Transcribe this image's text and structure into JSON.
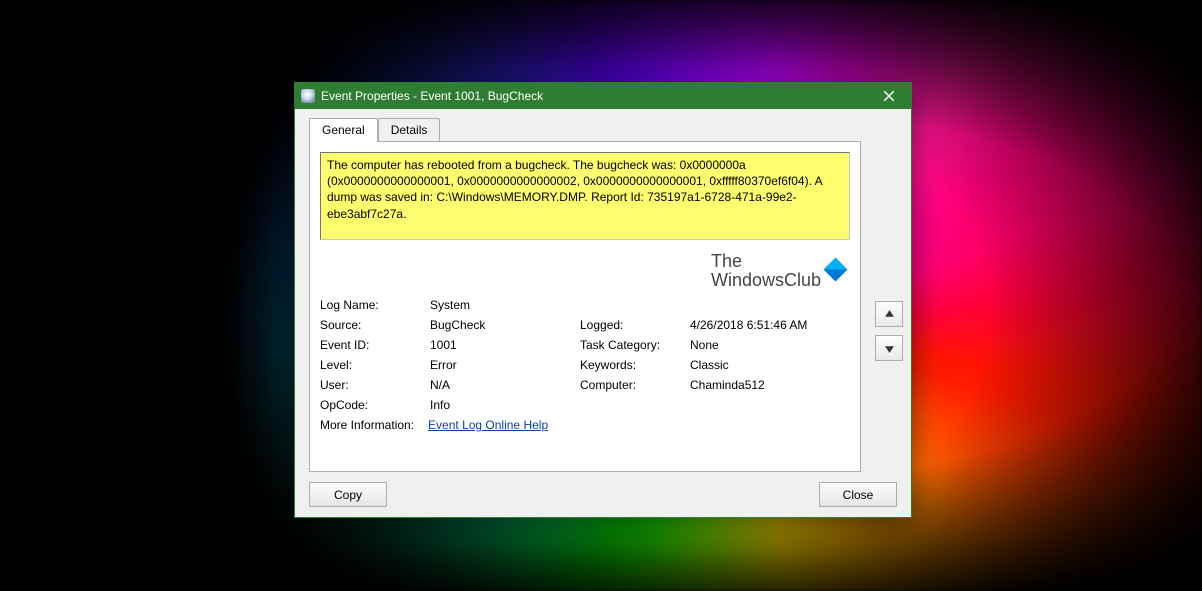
{
  "titlebar": {
    "title": "Event Properties - Event 1001, BugCheck"
  },
  "tabs": {
    "general": "General",
    "details": "Details"
  },
  "event": {
    "message": "The computer has rebooted from a bugcheck.  The bugcheck was: 0x0000000a (0x0000000000000001, 0x0000000000000002, 0x0000000000000001, 0xfffff80370ef6f04). A dump was saved in: C:\\Windows\\MEMORY.DMP. Report Id: 735197a1-6728-471a-99e2-ebe3abf7c27a."
  },
  "labels": {
    "log_name": "Log Name:",
    "source": "Source:",
    "event_id": "Event ID:",
    "level": "Level:",
    "user": "User:",
    "opcode": "OpCode:",
    "logged": "Logged:",
    "task_category": "Task Category:",
    "keywords": "Keywords:",
    "computer": "Computer:",
    "more_info": "More Information:"
  },
  "values": {
    "log_name": "System",
    "source": "BugCheck",
    "event_id": "1001",
    "level": "Error",
    "user": "N/A",
    "opcode": "Info",
    "logged": "4/26/2018 6:51:46 AM",
    "task_category": "None",
    "keywords": "Classic",
    "computer": "Chaminda512"
  },
  "links": {
    "online_help": "Event Log Online Help"
  },
  "buttons": {
    "copy": "Copy",
    "close": "Close"
  },
  "watermark": {
    "line1": "The",
    "line2": "WindowsClub"
  }
}
